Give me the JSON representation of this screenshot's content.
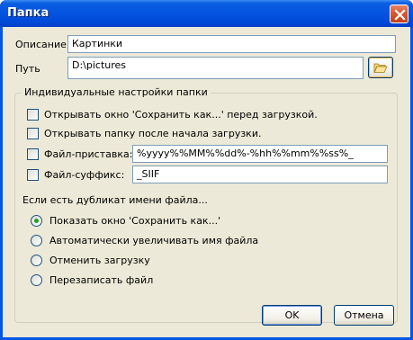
{
  "window": {
    "title": "Папка"
  },
  "fields": {
    "description_label": "Описание",
    "description_value": "Картинки",
    "path_label": "Путь",
    "path_value": "D:\\pictures"
  },
  "group": {
    "title": "Индивидуальные настройки папки",
    "checkboxes": [
      {
        "label": "Открывать окно 'Сохранить как...' перед загрузкой.",
        "checked": false
      },
      {
        "label": "Открывать папку после начала загрузки.",
        "checked": false
      },
      {
        "label": "Файл-приставка:",
        "checked": false
      },
      {
        "label": "Файл-суффикс:",
        "checked": false
      }
    ],
    "prefix_value": "%yyyy%%MM%%dd%-%hh%%mm%%ss%_",
    "suffix_value": "_SIIF",
    "duplicate_label": "Если есть дубликат имени файла...",
    "radios": [
      {
        "label": "Показать окно 'Сохранить как...'",
        "checked": true
      },
      {
        "label": "Автоматически увеличивать имя файла",
        "checked": false
      },
      {
        "label": "Отменить загрузку",
        "checked": false
      },
      {
        "label": "Перезаписать файл",
        "checked": false
      }
    ]
  },
  "buttons": {
    "ok": "OK",
    "cancel": "Отмена"
  },
  "icons": {
    "close": "close-icon",
    "browse": "folder-open-icon"
  },
  "colors": {
    "titlebar": "#0454e1",
    "client_bg": "#ece9d8",
    "close": "#d45a33",
    "radio_dot": "#21a121"
  }
}
